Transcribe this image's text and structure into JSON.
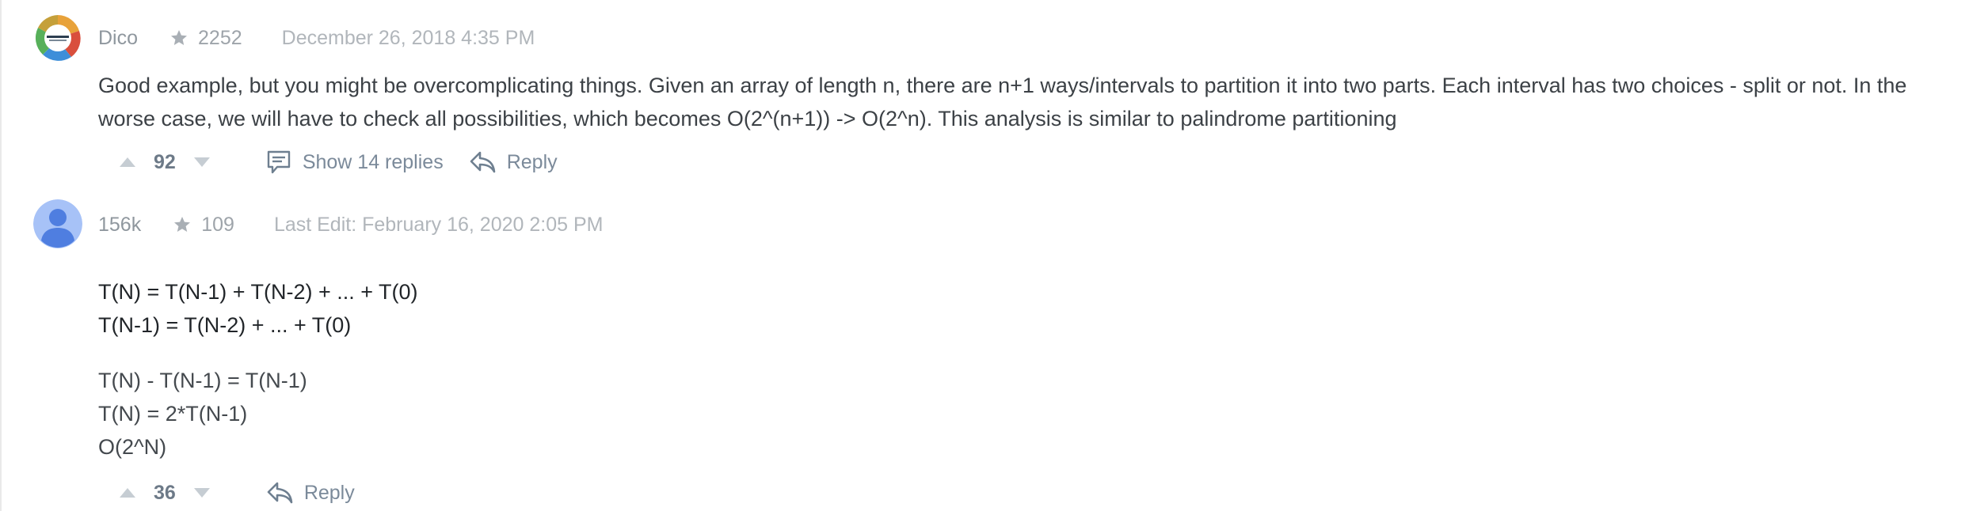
{
  "comments": [
    {
      "username": "Dico",
      "reputation": "2252",
      "date": "December 26, 2018 4:35 PM",
      "body": "Good example, but you might be overcomplicating things. Given an array of length n, there are n+1 ways/intervals to partition it into two parts. Each interval has two choices - split or not. In the worse case, we will have to check all possibilities, which becomes O(2^(n+1)) -> O(2^n). This analysis is similar to palindrome partitioning",
      "votes": "92",
      "replies_label": "Show 14 replies",
      "reply_label": "Reply",
      "avatar_icon": "logo-badge-icon"
    },
    {
      "username": "156k",
      "reputation": "109",
      "date": "Last Edit: February 16, 2020 2:05 PM",
      "code_lines": [
        "T(N) = T(N-1) + T(N-2) + ... + T(0)",
        "T(N-1) = T(N-2) + ... + T(0)"
      ],
      "text_lines": [
        "T(N) - T(N-1) = T(N-1)",
        "T(N) = 2*T(N-1)",
        "O(2^N)"
      ],
      "votes": "36",
      "reply_label": "Reply",
      "avatar_icon": "default-user-avatar-icon"
    }
  ],
  "icons": {
    "star": "star-icon",
    "upvote": "caret-up-icon",
    "downvote": "caret-down-icon",
    "replies": "comment-icon",
    "reply": "reply-arrow-icon"
  },
  "colors": {
    "avatar_blue": "#9fbdf6",
    "avatar_blue_dark": "#4f7ee0",
    "meta_text": "#9ea4aa",
    "action_text": "#7b8a9a"
  }
}
